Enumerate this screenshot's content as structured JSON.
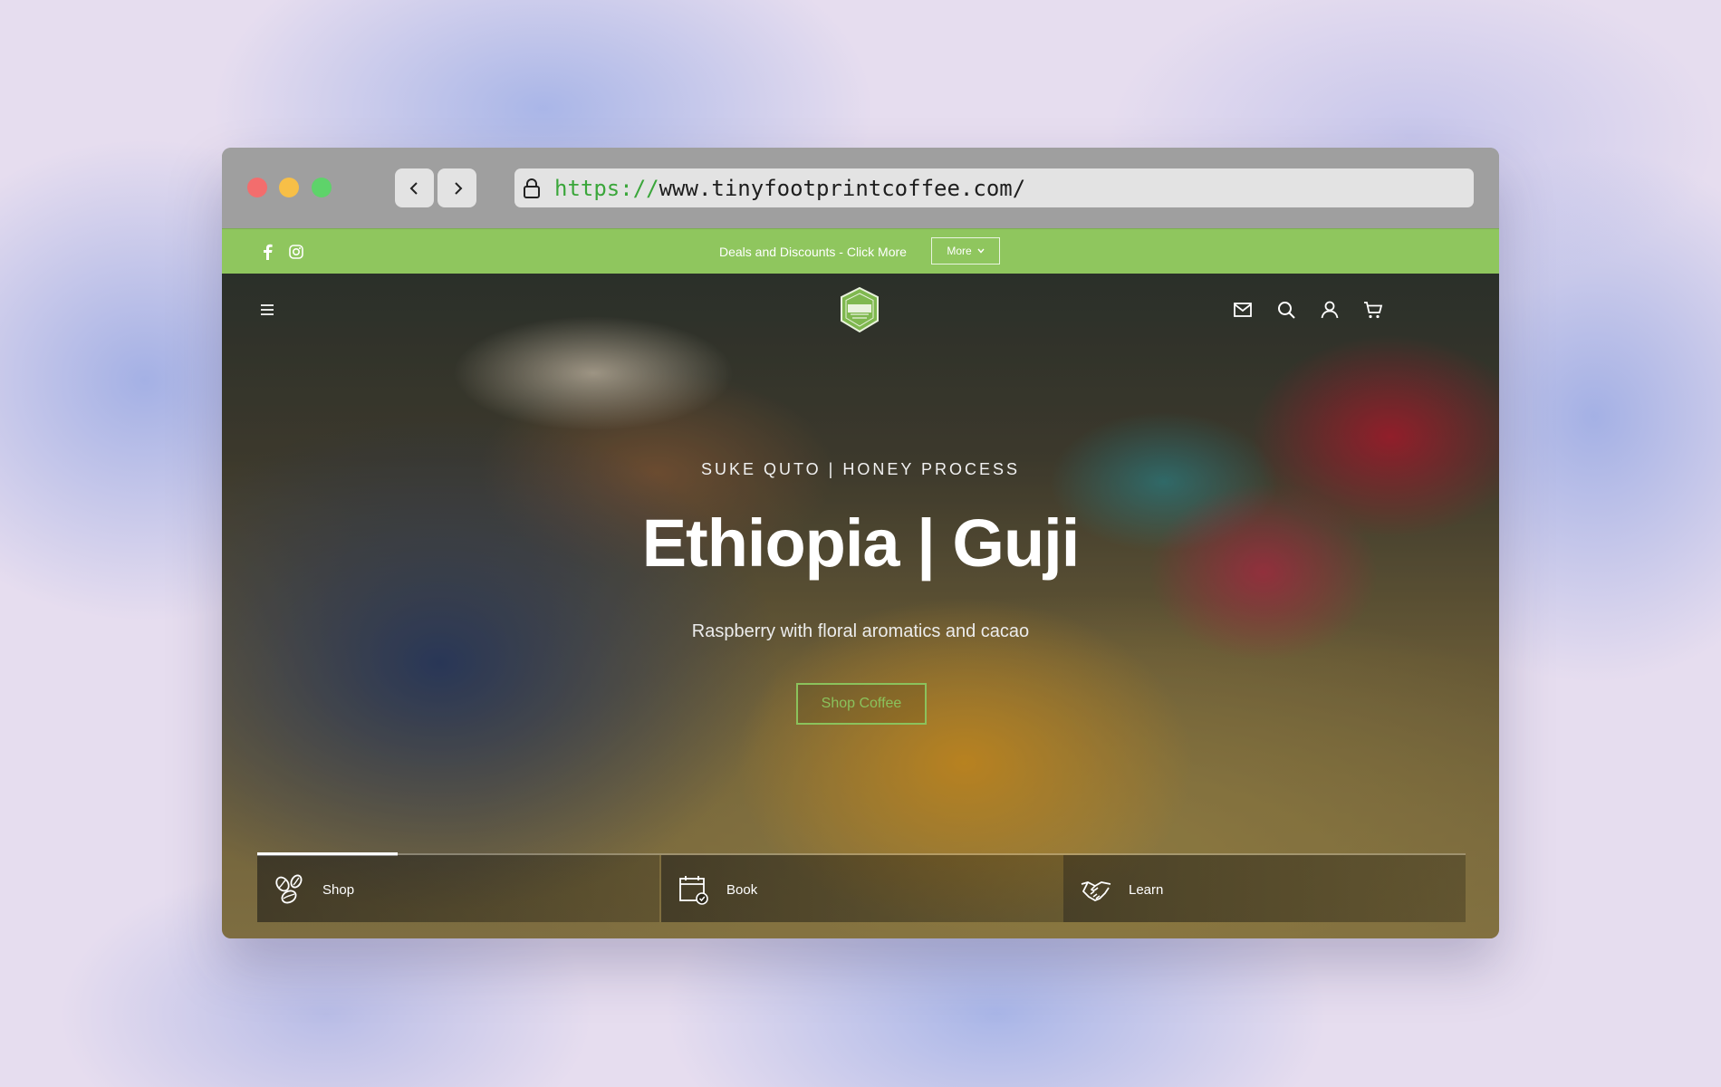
{
  "browser": {
    "url_scheme": "https://",
    "url_rest": "www.tinyfootprintcoffee.com/"
  },
  "promo_bar": {
    "text": "Deals and Discounts - Click More",
    "more_label": "More",
    "background": "#8fc65e"
  },
  "header": {
    "logo_name": "tiny-footprint-coffee-logo",
    "icons": [
      "menu-icon",
      "mail-icon",
      "search-icon",
      "account-icon",
      "cart-icon"
    ]
  },
  "hero": {
    "kicker": "SUKE QUTO | HONEY PROCESS",
    "title": "Ethiopia | Guji",
    "subtitle": "Raspberry with floral aromatics and cacao",
    "cta_label": "Shop Coffee",
    "accent": "#8bc25c"
  },
  "tabs": [
    {
      "label": "Shop",
      "icon": "coffee-beans-icon",
      "active": true
    },
    {
      "label": "Book",
      "icon": "calendar-check-icon",
      "active": false
    },
    {
      "label": "Learn",
      "icon": "handshake-icon",
      "active": false
    }
  ]
}
